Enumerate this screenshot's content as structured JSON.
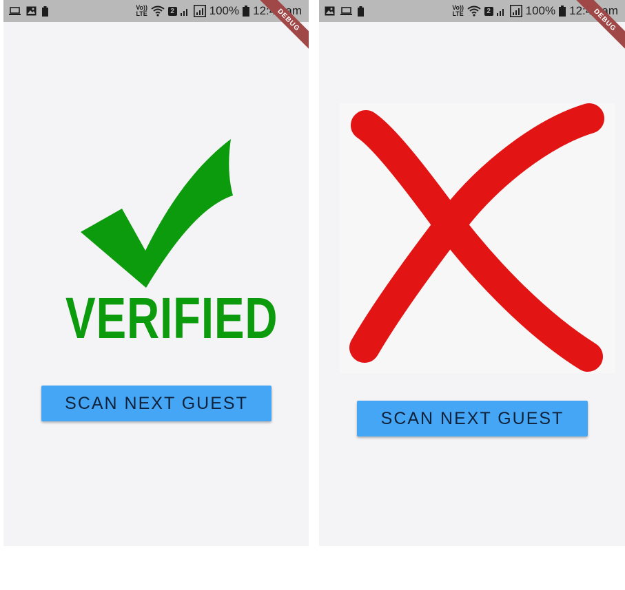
{
  "screens": [
    {
      "status_bar": {
        "battery_percent": "100%",
        "time": "12:44 am",
        "sim_slot": "2",
        "network": "Vo)) LTE"
      },
      "debug_banner": "DEBUG",
      "result": {
        "label": "VERIFIED",
        "color": "#0c9b0c"
      },
      "scan_button_label": "SCAN NEXT GUEST"
    },
    {
      "status_bar": {
        "battery_percent": "100%",
        "time": "12:44 am",
        "sim_slot": "2",
        "network": "Vo)) LTE"
      },
      "debug_banner": "DEBUG",
      "result": {
        "icon": "red-x-icon",
        "color": "#e21414"
      },
      "scan_button_label": "SCAN NEXT GUEST"
    }
  ],
  "colors": {
    "button": "#45a6f6",
    "status_bar": "#b9b9b9",
    "background": "#f4f3f5",
    "debug_ribbon": "#a04848"
  }
}
